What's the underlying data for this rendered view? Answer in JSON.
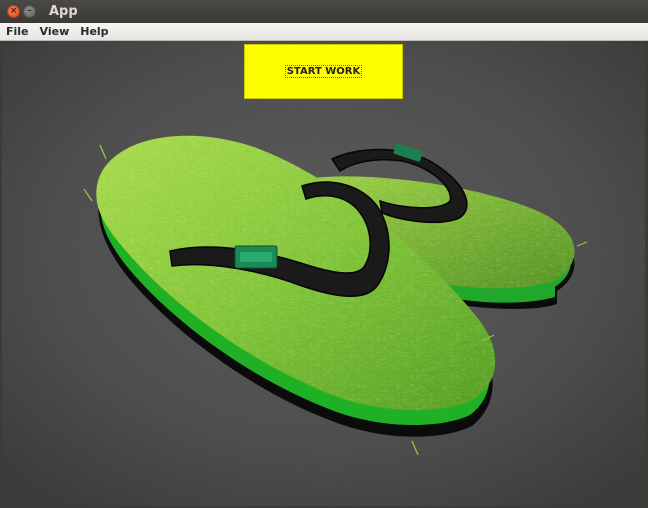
{
  "window": {
    "title": "App",
    "close_glyph": "×",
    "minimize_glyph": "–"
  },
  "menubar": {
    "items": [
      {
        "label": "File"
      },
      {
        "label": "View"
      },
      {
        "label": "Help"
      }
    ]
  },
  "main": {
    "start_button_label": "START WORK",
    "start_button_color": "#ffff00",
    "image_subject": "grass-flip-flops-photo"
  }
}
